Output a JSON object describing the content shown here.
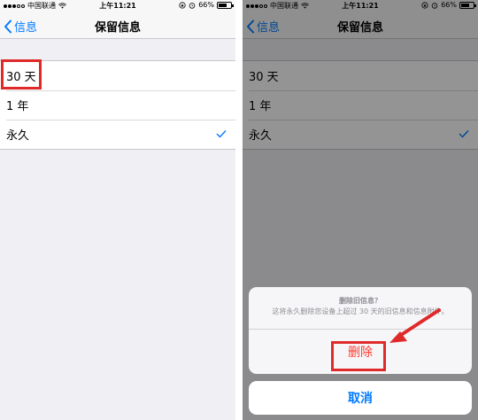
{
  "status_bar": {
    "carrier": "中国联通",
    "time": "上午11:21",
    "battery": "66%"
  },
  "nav": {
    "back_label": "信息",
    "title": "保留信息"
  },
  "options": [
    {
      "label": "30 天",
      "selected": false
    },
    {
      "label": "1 年",
      "selected": false
    },
    {
      "label": "永久",
      "selected": true
    }
  ],
  "action_sheet": {
    "title": "删除旧信息？",
    "message": "这将永久删除您设备上超过 30 天的旧信息和信息附件。",
    "delete_label": "删除",
    "cancel_label": "取消"
  },
  "colors": {
    "accent": "#007aff",
    "destructive": "#ff3b30",
    "highlight": "#e02a2a"
  }
}
